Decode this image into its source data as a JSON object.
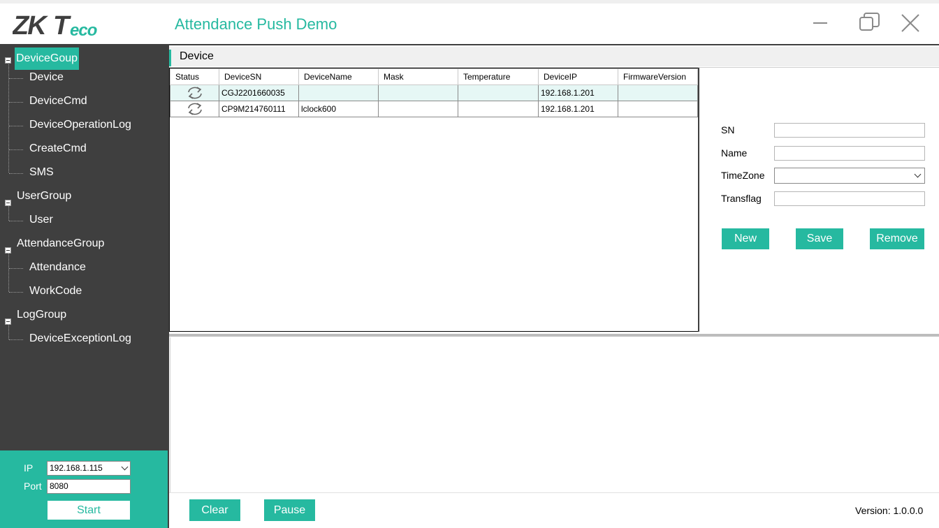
{
  "app": {
    "logo_text": "ZKTeco",
    "title": "Attendance Push Demo"
  },
  "window_controls": [
    "minimize-icon",
    "restore-icon",
    "close-icon"
  ],
  "colors": {
    "accent": "#26b9a0",
    "sidebar": "#3f3f3f",
    "selected_row": "#e6f7f5"
  },
  "sidebar": {
    "groups": [
      {
        "label": "DeviceGoup",
        "active": true,
        "items": [
          "Device",
          "DeviceCmd",
          "DeviceOperationLog",
          "CreateCmd",
          "SMS"
        ]
      },
      {
        "label": "UserGroup",
        "items": [
          "User"
        ]
      },
      {
        "label": "AttendanceGroup",
        "items": [
          "Attendance",
          "WorkCode"
        ]
      },
      {
        "label": "LogGroup",
        "items": [
          "DeviceExceptionLog"
        ]
      }
    ]
  },
  "connection": {
    "ip_label": "IP",
    "ip_value": "192.168.1.115",
    "port_label": "Port",
    "port_value": "8080",
    "start_label": "Start"
  },
  "section": {
    "title": "Device"
  },
  "grid": {
    "columns": [
      "Status",
      "DeviceSN",
      "DeviceName",
      "Mask",
      "Temperature",
      "DeviceIP",
      "FirmwareVersion"
    ],
    "rows": [
      {
        "status_icon": "sync-icon",
        "sn": "CGJ2201660035",
        "name": "",
        "mask": "",
        "temperature": "",
        "ip": "192.168.1.201",
        "firmware": ""
      },
      {
        "status_icon": "sync-icon",
        "sn": "CP9M214760111",
        "name": "lclock600",
        "mask": "",
        "temperature": "",
        "ip": "192.168.1.201",
        "firmware": ""
      }
    ]
  },
  "form": {
    "sn_label": "SN",
    "sn_value": "",
    "name_label": "Name",
    "name_value": "",
    "timezone_label": "TimeZone",
    "timezone_value": "",
    "transflag_label": "Transflag",
    "transflag_value": "",
    "new_label": "New",
    "save_label": "Save",
    "remove_label": "Remove"
  },
  "footer": {
    "clear_label": "Clear",
    "pause_label": "Pause",
    "version": "Version: 1.0.0.0"
  }
}
